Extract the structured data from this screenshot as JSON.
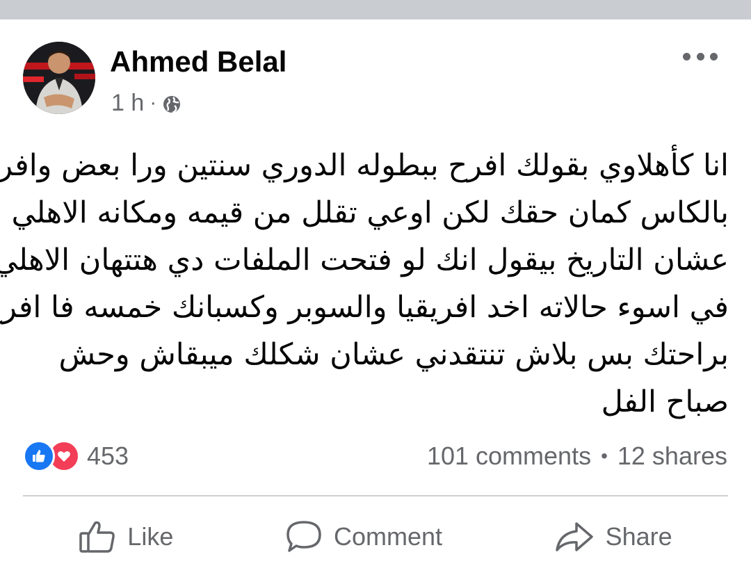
{
  "post": {
    "author": "Ahmed Belal",
    "time": "1 h",
    "meta_separator": "·",
    "privacy_icon": "globe-icon",
    "more_icon": "more-dots-icon",
    "text_lines": [
      "انا كأهلاوي بقولك افرح ببطوله الدوري سنتين ورا بعض وافرح",
      "بالكاس كمان  حقك لكن اوعي تقلل من قيمه ومكانه الاهلي",
      "عشان التاريخ بيقول انك لو فتحت الملفات دي هتتهان  الاهلي",
      "في اسوء حالاته اخد افريقيا والسوبر  وكسبانك خمسه  فا افرح",
      "براحتك بس بلاش تنتقدني عشان شكلك ميبقاش وحش",
      "صباح الفل"
    ]
  },
  "stats": {
    "reaction_count": "453",
    "comments": "101 comments",
    "separator": "•",
    "shares": "12 shares"
  },
  "actions": {
    "like_label": "Like",
    "comment_label": "Comment",
    "share_label": "Share"
  },
  "colors": {
    "like_blue": "#1877f2",
    "love_red": "#f33e58",
    "secondary_text": "#65676b",
    "top_bar": "#c9ccd1"
  }
}
